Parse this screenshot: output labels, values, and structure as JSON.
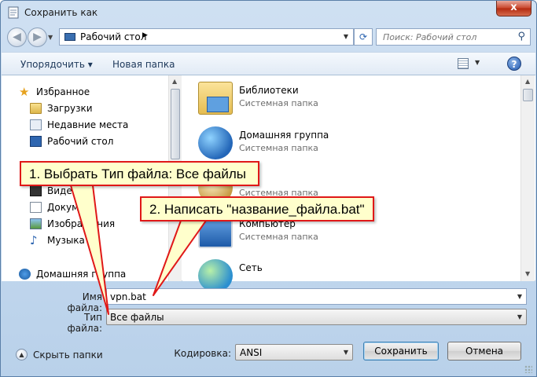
{
  "window": {
    "title": "Сохранить как",
    "close_glyph": "x"
  },
  "address_bar": {
    "path": "Рабочий стол",
    "separator": "▶",
    "dropdown_glyph": "▼"
  },
  "search": {
    "placeholder": "Поиск: Рабочий стол"
  },
  "toolbar": {
    "organize_label": "Упорядочить ▾",
    "new_folder_label": "Новая папка",
    "help_glyph": "?"
  },
  "nav_pane": {
    "items": [
      {
        "label": "Избранное",
        "icon": "star-icon"
      },
      {
        "label": "Загрузки",
        "icon": "folder-icon"
      },
      {
        "label": "Недавние места",
        "icon": "recent-places-icon"
      },
      {
        "label": "Рабочий стол",
        "icon": "desktop-icon"
      },
      {
        "label": "Виде",
        "icon": "video-icon"
      },
      {
        "label": "Докум",
        "icon": "document-icon"
      },
      {
        "label": "Изображения",
        "icon": "picture-icon"
      },
      {
        "label": "Музыка",
        "icon": "music-icon"
      },
      {
        "label": "Домашняя группа",
        "icon": "homegroup-icon"
      }
    ]
  },
  "file_pane": {
    "items": [
      {
        "name": "Библиотеки",
        "type": "Системная папка",
        "icon": "libraries-icon"
      },
      {
        "name": "Домашняя группа",
        "type": "Системная папка",
        "icon": "homegroup-icon"
      },
      {
        "name": "",
        "type": "Системная папка",
        "icon": "user-folder-icon"
      },
      {
        "name": "Компьютер",
        "type": "Системная папка",
        "icon": "computer-icon"
      },
      {
        "name": "Сеть",
        "type": "",
        "icon": "network-icon"
      }
    ]
  },
  "form": {
    "filename_label": "Имя файла:",
    "filename_value": "vpn.bat",
    "filetype_label": "Тип файла:",
    "filetype_value": "Все файлы",
    "encoding_label": "Кодировка:",
    "encoding_value": "ANSI"
  },
  "buttons": {
    "hide_folders": "Скрыть папки",
    "save": "Сохранить",
    "cancel": "Отмена"
  },
  "annotations": {
    "step1": "1. Выбрать Тип файла: Все файлы",
    "step2": "2. Написать \"название_файла.bat\"",
    "border_color": "#e01818",
    "fill_color": "#ffffcc"
  }
}
